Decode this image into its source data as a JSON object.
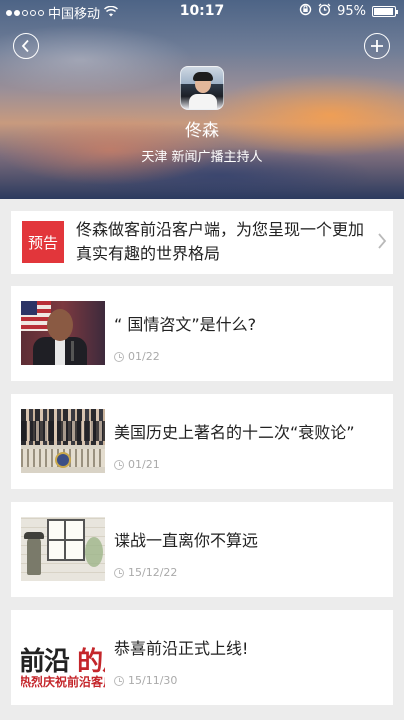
{
  "status_bar": {
    "carrier": "中国移动",
    "time": "10:17",
    "battery": "95%",
    "battery_level": 0.95
  },
  "header": {
    "back_icon": "chevron-left-icon",
    "add_icon": "plus-icon",
    "name": "佟森",
    "subtitle": "天津 新闻广播主持人"
  },
  "notice": {
    "badge": "预告",
    "text": "佟森做客前沿客户端，为您呈现一个更加真实有趣的世界格局"
  },
  "articles": [
    {
      "title": "“ 国情咨文”是什么?",
      "date": "01/22"
    },
    {
      "title": "美国历史上著名的十二次“衰败论”",
      "date": "01/21"
    },
    {
      "title": "谍战一直离你不算远",
      "date": "15/12/22"
    },
    {
      "title": "恭喜前沿正式上线!",
      "date": "15/11/30"
    }
  ],
  "thumb4": {
    "line1a": "前沿",
    "line1b": "的从",
    "line2": "热烈庆祝前沿客户"
  },
  "colors": {
    "accent_red": "#e2363b",
    "card_bg": "#ffffff",
    "page_bg": "#ececec"
  }
}
